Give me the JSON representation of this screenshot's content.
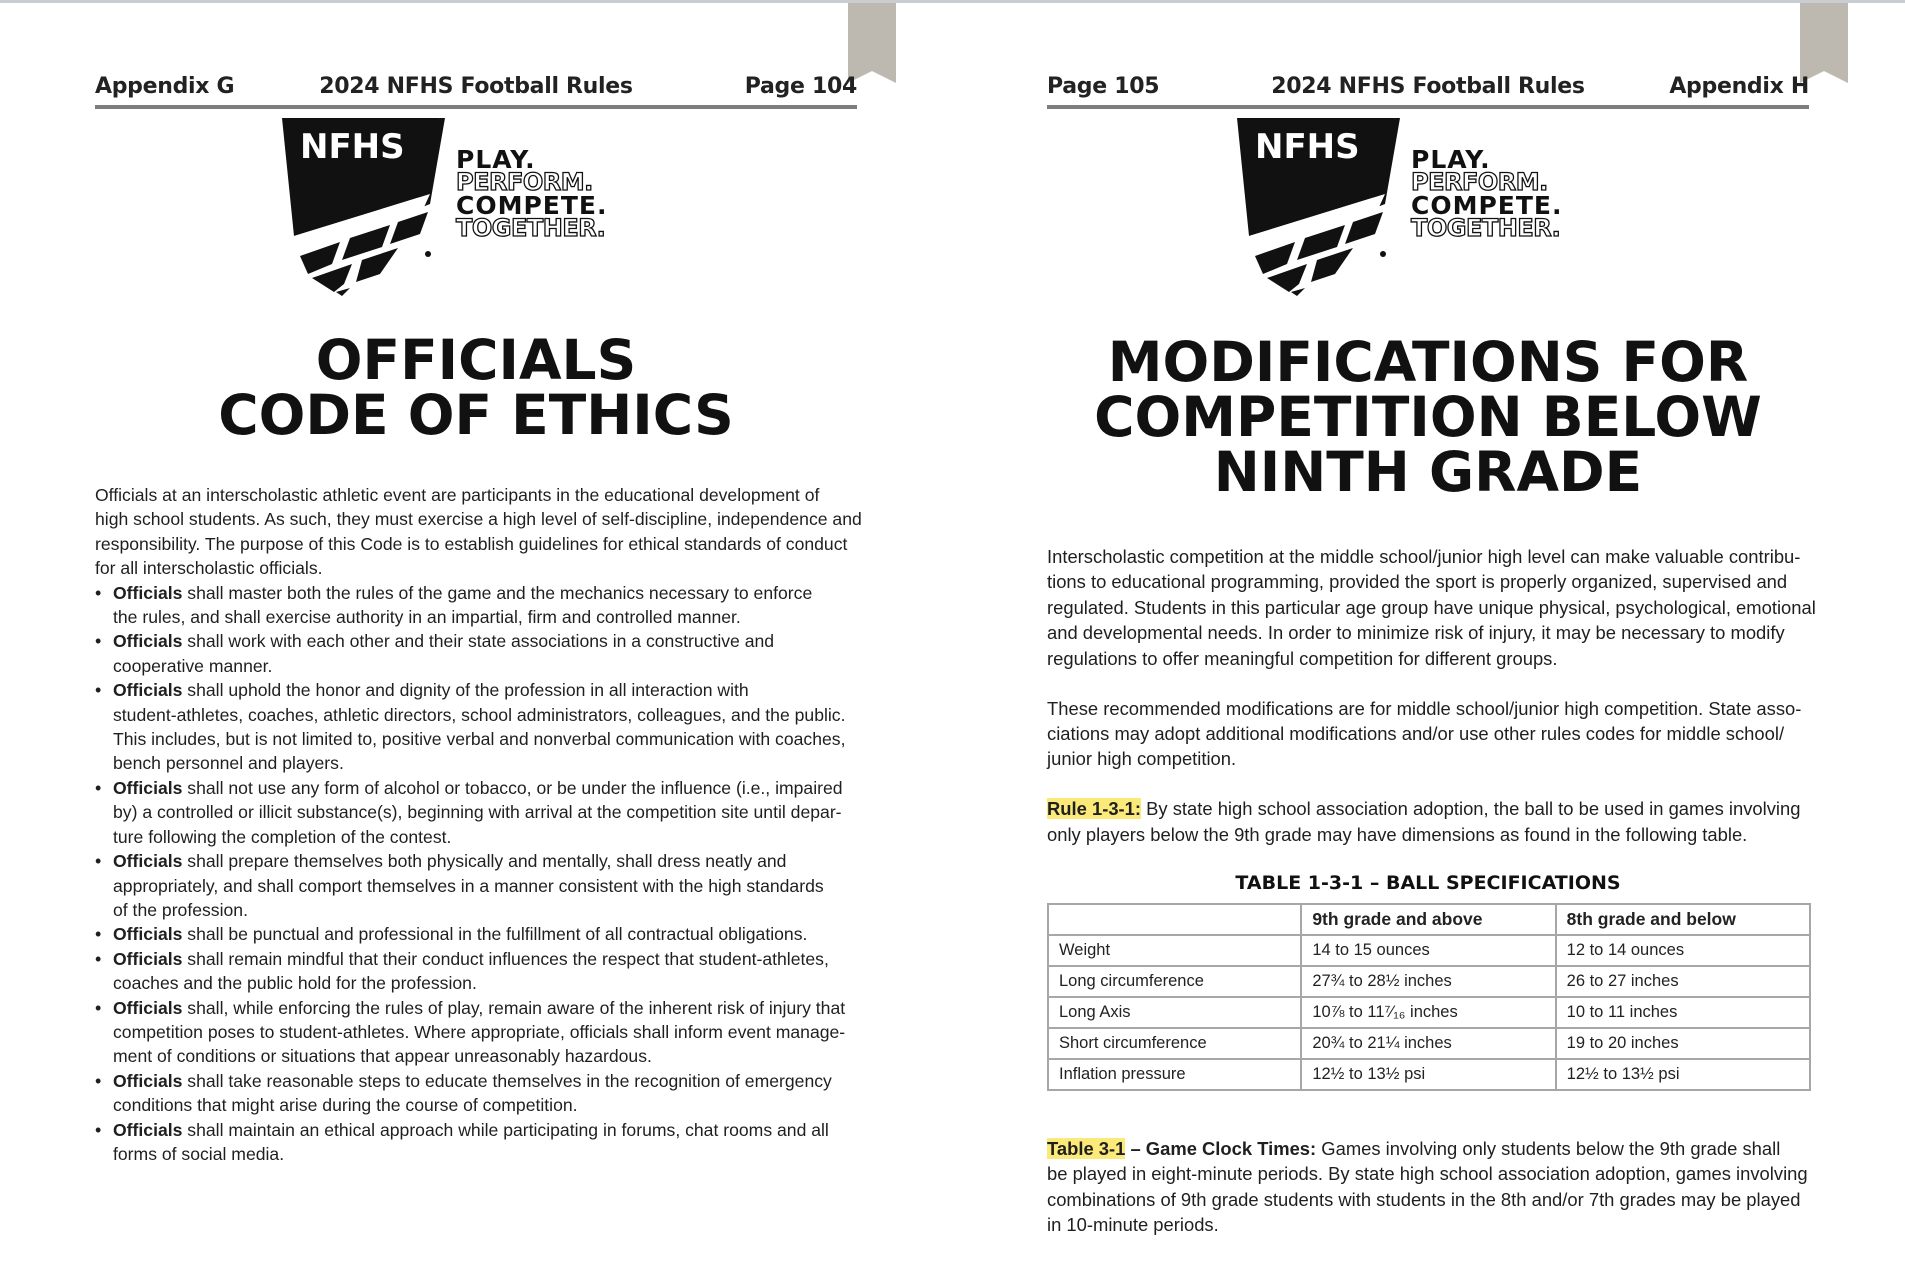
{
  "left_page": {
    "header": {
      "left": "Appendix G",
      "center": "2024 NFHS Football Rules",
      "right": "Page 104"
    },
    "logo": {
      "brand": "NFHS",
      "tagline": [
        "PLAY.",
        "PERFORM.",
        "COMPETE.",
        "TOGETHER."
      ]
    },
    "title": [
      "OFFICIALS",
      "CODE OF ETHICS"
    ],
    "intro_lines": [
      "Officials at an interscholastic athletic event are participants in the educational development of",
      "high school students. As such, they must exercise a high level of self-discipline, independence and",
      "responsibility. The purpose of this Code is to establish guidelines for ethical standards of conduct",
      "for all interscholastic officials."
    ],
    "bullet_lead": "Officials",
    "bullets": [
      [
        " shall master both the rules of the game and the mechanics necessary to enforce",
        "the rules, and shall exercise authority in an impartial, firm and controlled manner."
      ],
      [
        " shall work with each other and their state associations in a constructive and",
        "cooperative manner."
      ],
      [
        " shall uphold the honor and dignity of the profession in all interaction with",
        "student-athletes, coaches, athletic directors, school administrators, colleagues, and the public.",
        "This includes, but is not limited to, positive verbal and nonverbal communication with coaches,",
        "bench personnel and players."
      ],
      [
        " shall not use any form of alcohol or tobacco, or be under the influence (i.e., impaired",
        "by) a controlled or illicit substance(s), beginning with arrival at the competition site until depar-",
        "ture following the completion of the contest."
      ],
      [
        " shall prepare themselves both physically and mentally, shall dress neatly and",
        "appropriately, and shall comport themselves in a manner consistent with the high standards",
        "of the profession."
      ],
      [
        " shall be punctual and professional in the fulfillment of all contractual obligations."
      ],
      [
        " shall remain mindful that their conduct influences the respect that student-athletes,",
        "coaches and the public hold for the profession."
      ],
      [
        " shall, while enforcing the rules of play, remain aware of the inherent risk of injury that",
        "competition poses to student-athletes. Where appropriate, officials shall inform event manage-",
        "ment of conditions or situations that appear unreasonably hazardous."
      ],
      [
        " shall take reasonable steps to educate themselves in the recognition of emergency",
        "conditions that might arise during the course of competition."
      ],
      [
        " shall maintain an ethical approach while participating in forums, chat rooms and all",
        "forms of social media."
      ]
    ]
  },
  "right_page": {
    "header": {
      "left": "Page 105",
      "center": "2024 NFHS Football Rules",
      "right": "Appendix H"
    },
    "logo": {
      "brand": "NFHS",
      "tagline": [
        "PLAY.",
        "PERFORM.",
        "COMPETE.",
        "TOGETHER."
      ]
    },
    "title": [
      "MODIFICATIONS FOR",
      "COMPETITION BELOW",
      "NINTH GRADE"
    ],
    "para1_lines": [
      "Interscholastic competition at the middle school/junior high level can make valuable contribu-",
      "tions to educational programming, provided the sport is properly organized, supervised and",
      "regulated. Students in this particular age group have unique physical, psychological, emotional",
      "and developmental needs. In order to minimize risk of injury, it may be necessary to modify",
      "regulations to offer meaningful competition for different groups."
    ],
    "para2_lines": [
      "These recommended modifications are for middle school/junior high competition. State asso-",
      "ciations may adopt additional modifications and/or use other rules codes for middle school/",
      "junior high competition."
    ],
    "rule": {
      "label": "Rule 1-3-1:",
      "lines": [
        " By state high school association adoption, the ball to be used in games involving",
        "only players below the 9th grade may have dimensions as found in the following table."
      ]
    },
    "table": {
      "title": "TABLE 1-3-1 – BALL SPECIFICATIONS",
      "headers": [
        "",
        "9th grade and above",
        "8th grade and below"
      ],
      "rows": [
        [
          "Weight",
          "14 to 15 ounces",
          "12 to 14 ounces"
        ],
        [
          "Long circumference",
          "27¾ to 28½ inches",
          "26 to 27 inches"
        ],
        [
          "Long Axis",
          "10⅞ to 11⁷⁄₁₆ inches",
          "10 to 11 inches"
        ],
        [
          "Short circumference",
          "20¾ to 21¼ inches",
          "19 to 20 inches"
        ],
        [
          "Inflation pressure",
          "12½ to 13½ psi",
          "12½ to 13½ psi"
        ]
      ]
    },
    "clock": {
      "label": "Table 3-1",
      "heading": " – Game Clock Times:",
      "lines": [
        " Games involving only students below the 9th grade shall",
        "be played in eight-minute periods. By state high school association adoption, games involving",
        "combinations of 9th grade students with students in the 8th and/or 7th grades may be played",
        "in 10-minute periods."
      ]
    }
  }
}
